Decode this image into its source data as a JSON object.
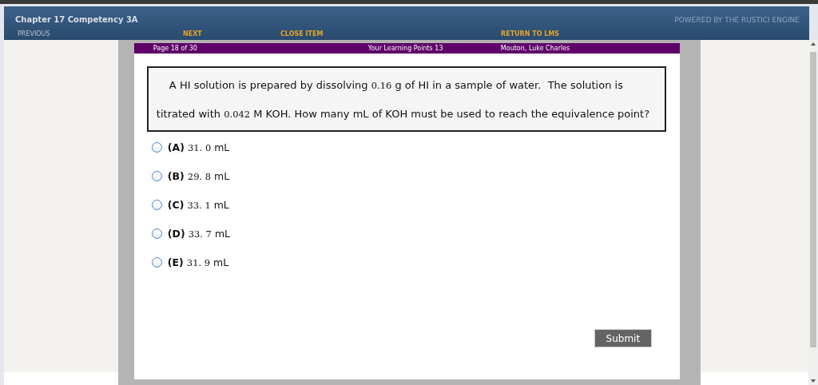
{
  "header": {
    "title": "Chapter 17 Competency 3A",
    "powered_by": "POWERED BY THE RUSTICI ENGINE",
    "nav": [
      {
        "label": "PREVIOUS",
        "disabled": true
      },
      {
        "label": "NEXT",
        "disabled": false
      },
      {
        "label": "CLOSE ITEM",
        "disabled": false
      },
      {
        "label": "RETURN TO LMS",
        "disabled": false
      }
    ]
  },
  "info_bar": {
    "page": "Page 18 of 30",
    "points": "Your Learning Points 13",
    "user": "Mouton, Luke Charles"
  },
  "question": {
    "lines": [
      [
        {
          "kind": "text",
          "text": "A HI solution is prepared by dissolving "
        },
        {
          "kind": "number",
          "text": "0.16"
        },
        {
          "kind": "text",
          "text": " g of HI in a sample of water.  The solution is"
        }
      ],
      [
        {
          "kind": "text",
          "text": "titrated with "
        },
        {
          "kind": "number",
          "text": "0.042"
        },
        {
          "kind": "text",
          "text": " M KOH. How many mL of KOH must be used to reach the equivalence point?"
        }
      ]
    ]
  },
  "options": [
    {
      "letter": "(A)",
      "value": "31. 0",
      "unit": "mL",
      "selected": false
    },
    {
      "letter": "(B)",
      "value": "29. 8",
      "unit": "mL",
      "selected": false
    },
    {
      "letter": "(C)",
      "value": "33. 1",
      "unit": "mL",
      "selected": false
    },
    {
      "letter": "(D)",
      "value": "33. 7",
      "unit": "mL",
      "selected": false
    },
    {
      "letter": "(E)",
      "value": "31. 9",
      "unit": "mL",
      "selected": false
    }
  ],
  "submit": "Submit"
}
